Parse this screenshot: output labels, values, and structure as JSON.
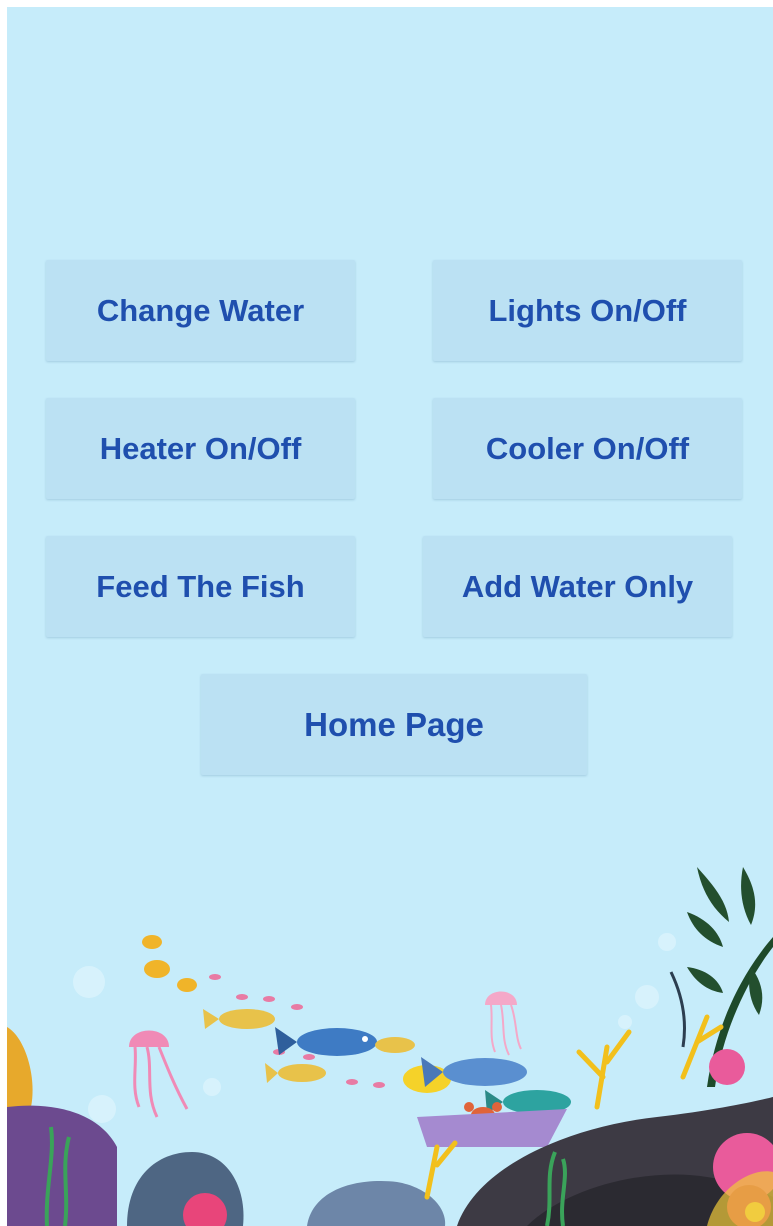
{
  "colors": {
    "background": "#c6ecfa",
    "button_fill": "#bbe1f3",
    "button_text": "#1f4fae"
  },
  "buttons": {
    "change_water": "Change Water",
    "lights": "Lights On/Off",
    "heater": "Heater On/Off",
    "cooler": "Cooler On/Off",
    "feed": "Feed The Fish",
    "add_water": "Add Water Only",
    "home": "Home Page"
  },
  "illustration": {
    "subject": "underwater coral reef with fish, jellyfish and crab"
  }
}
